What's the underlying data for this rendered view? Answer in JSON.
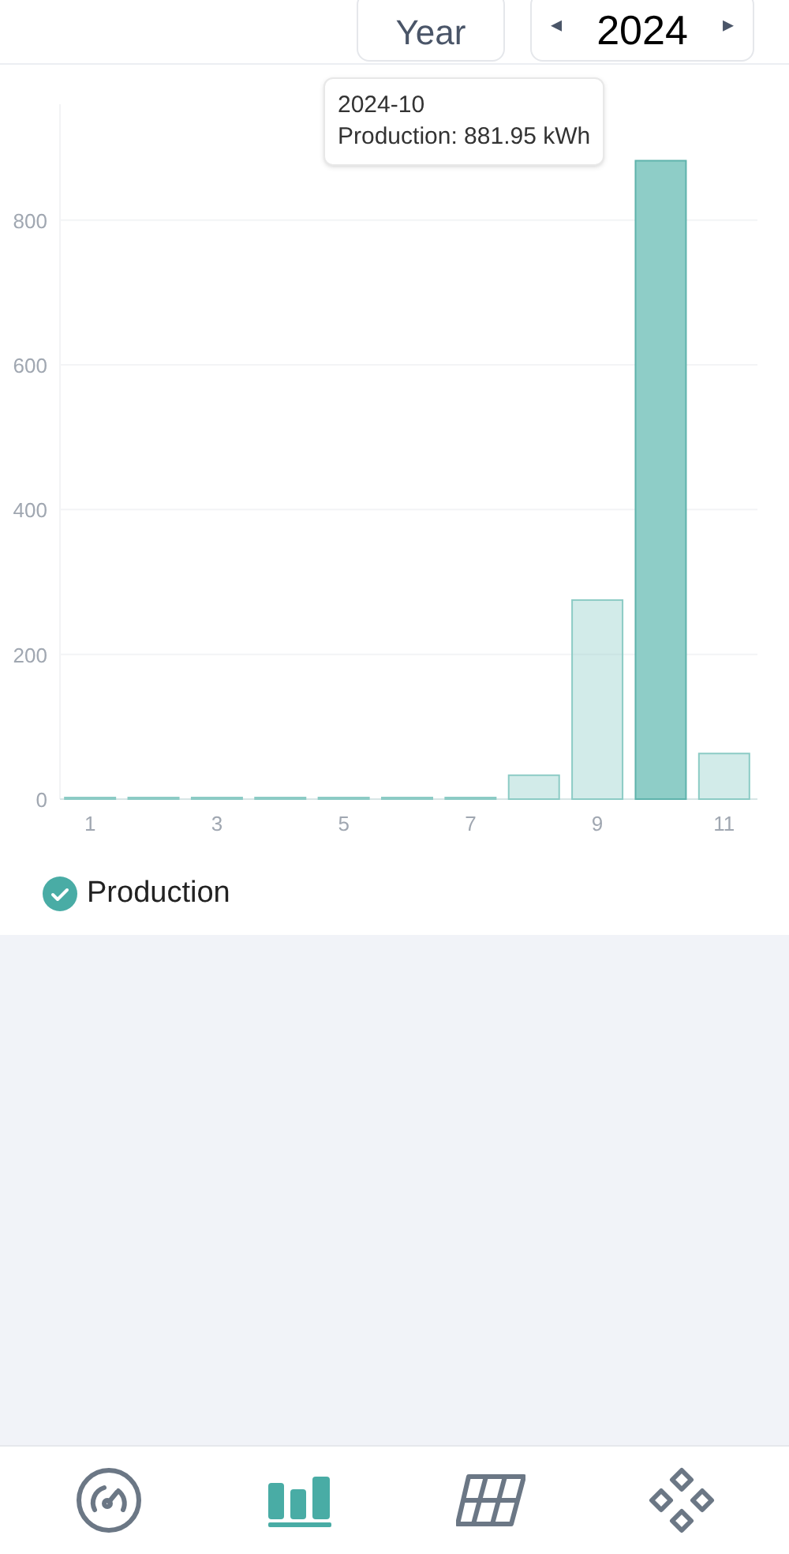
{
  "header": {
    "period": {
      "label": "Year"
    },
    "year": {
      "value": "2024",
      "prev": "◂",
      "next": "▸"
    }
  },
  "chart": {
    "chart_data": {
      "type": "bar",
      "x": [
        1,
        2,
        3,
        4,
        5,
        6,
        7,
        8,
        9,
        10,
        11
      ],
      "xlim": [
        0.5,
        11.5
      ],
      "xticks": [
        1,
        3,
        5,
        7,
        9,
        11
      ],
      "yticks": [
        0,
        200,
        400,
        600,
        800
      ],
      "ylim": [
        0,
        960
      ],
      "grid": true,
      "series": [
        {
          "name": "Production",
          "color": "#8ecdc7",
          "values": [
            0,
            0,
            0,
            0,
            0,
            0,
            0,
            33,
            275,
            882,
            63
          ]
        }
      ]
    },
    "tooltip": {
      "title": "2024-10",
      "text": "Production: 881.95 kWh"
    },
    "legend": [
      {
        "checked": true
      }
    ]
  },
  "nav": {
    "items": [
      {
        "kind": "gauge",
        "selected": false
      },
      {
        "kind": "stats",
        "selected": true
      },
      {
        "kind": "panel",
        "selected": false
      },
      {
        "kind": "apps",
        "selected": false
      }
    ]
  }
}
